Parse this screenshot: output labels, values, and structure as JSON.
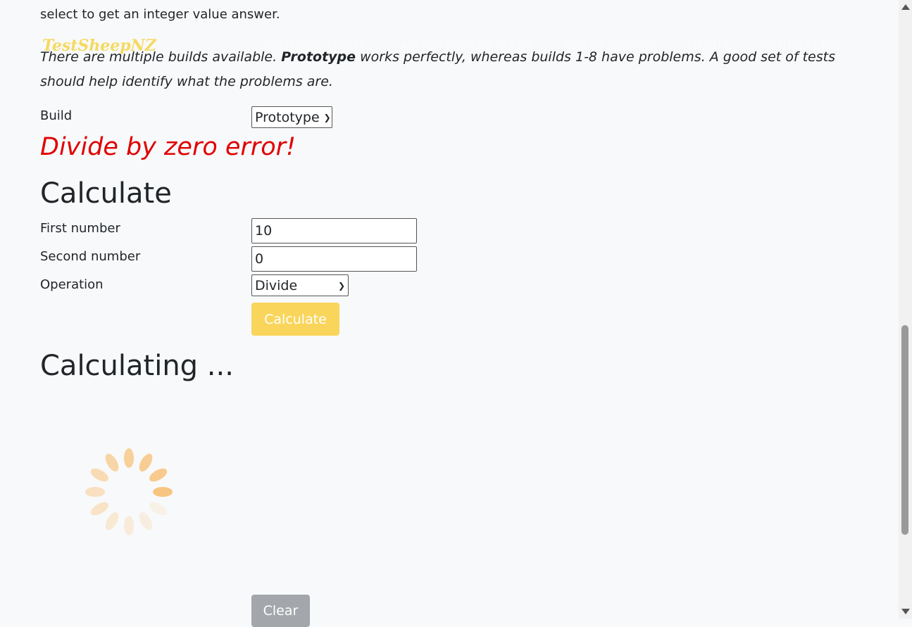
{
  "intro_text_1": "select to get an integer value answer.",
  "brand": "TestSheepNZ",
  "nav": {
    "items": [
      {
        "label": "Number Game"
      },
      {
        "label": "Automation Data"
      },
      {
        "label": "Workshops"
      },
      {
        "label": "Media"
      },
      {
        "label": "Mini Talks"
      }
    ]
  },
  "intro_text_2": {
    "before": "There are multiple builds available. ",
    "bold": "Prototype",
    "after": " works perfectly, whereas builds 1-8 have problems. A good set of tests should help identify what the problems are."
  },
  "build": {
    "label": "Build",
    "selected": "Prototype"
  },
  "error_message": "Divide by zero error!",
  "calculate_heading": "Calculate",
  "form": {
    "first_label": "First number",
    "first_value": "10",
    "second_label": "Second number",
    "second_value": "0",
    "operation_label": "Operation",
    "operation_selected": "Divide",
    "calculate_button": "Calculate"
  },
  "calculating_heading": "Calculating ...",
  "clear_button": "Clear",
  "colors": {
    "accent": "#f9d55b",
    "error": "#e00000",
    "spinner": "#f8c27a",
    "clear": "#a3a7ab"
  },
  "icons": {
    "spinner": "loading-spinner-icon",
    "chevron": "chevron-down-icon"
  }
}
